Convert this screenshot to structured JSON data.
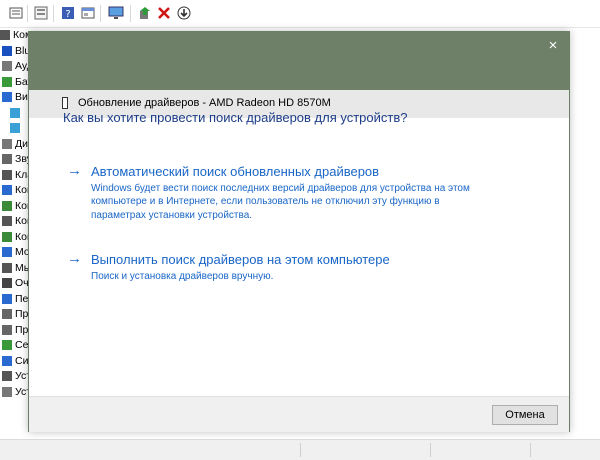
{
  "toolbar": {
    "icons": [
      "properties-icon",
      "view-icon",
      "help-icon",
      "window-icon",
      "monitor-icon",
      "update-driver-icon",
      "uninstall-icon",
      "download-icon"
    ]
  },
  "tree": {
    "items": [
      "Компь",
      "Blu",
      "Ауд",
      "Бат",
      "Вид",
      "",
      "",
      "Дис",
      "Зву",
      "Кла",
      "Ком",
      "Ком",
      "Кон",
      "Кон",
      "Мо",
      "Мы",
      "Оче",
      "Пер",
      "Про",
      "Про",
      "Сет",
      "Сис",
      "Уст",
      "Уст"
    ]
  },
  "dialog": {
    "title": "Обновление драйверов - AMD Radeon HD 8570M",
    "close_symbol": "×",
    "question": "Как вы хотите провести поиск драйверов для устройств?",
    "options": [
      {
        "arrow": "→",
        "title": "Автоматический поиск обновленных драйверов",
        "description": "Windows будет вести поиск последних версий драйверов для устройства на этом компьютере и в Интернете, если пользователь не отключил эту функцию в параметрах установки устройства."
      },
      {
        "arrow": "→",
        "title": "Выполнить поиск драйверов на этом компьютере",
        "description": "Поиск и установка драйверов вручную."
      }
    ],
    "cancel_label": "Отмена"
  },
  "colors": {
    "dialog_header": "#6e8168",
    "link_blue": "#1a66c7",
    "heading_blue": "#1d3d8a"
  }
}
